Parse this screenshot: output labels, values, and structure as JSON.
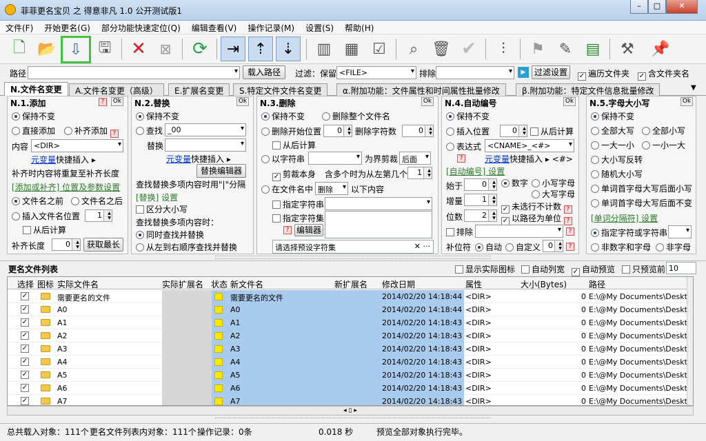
{
  "window": {
    "title": "菲菲更名宝贝 之 得意非凡 1.0 公开测试版1"
  },
  "menu": [
    "文件(F)",
    "开始更名(G)",
    "部分功能快速定位(Q)",
    "编辑查看(V)",
    "操作记录(M)",
    "设置(S)",
    "帮助(H)"
  ],
  "pathbar": {
    "path_label": "路径",
    "load_path": "载入路径",
    "filter_label": "过滤：保留",
    "filter_value": "<FILE>",
    "exclude_label": "排除",
    "filter_button": "过滤设置",
    "traverse_folder": "遍历文件夹",
    "include_folder_name": "含文件夹名"
  },
  "tabs": [
    "N.文件名变更",
    "A.文件名变更（高级）",
    "E.扩展名变更",
    "S.特定文件文件名变更",
    "α.附加功能：文件属性和时间属性批量修改",
    "β.附加功能：特定文件信息批量修改"
  ],
  "p1": {
    "title": "N.1.添加",
    "ok": "Ok",
    "keep": "保持不变",
    "direct_add": "直接添加",
    "pad_add": "补齐添加",
    "content_label": "内容",
    "content_value": "<DIR>",
    "meta_link": "元变量",
    "quick_insert": "快捷插入",
    "note": "补齐时内容将重复至补齐长度",
    "section": "[添加或补齐] 位置及参数设置",
    "before": "文件名之前",
    "after": "文件名之后",
    "insert_pos": "插入文件名位置",
    "insert_val": "1",
    "from_back": "从后计算",
    "pad_len_label": "补齐长度",
    "pad_len_val": "0",
    "get_longest": "获取最长"
  },
  "p2": {
    "title": "N.2.替换",
    "ok": "Ok",
    "keep": "保持不变",
    "find": "查找",
    "find_value": "_00",
    "replace": "替换",
    "meta_link": "元变量",
    "quick_insert": "快捷插入",
    "editor": "替换编辑器",
    "note": "查找替换多项内容时用\"|\"分隔",
    "section": "[替换] 设置",
    "case": "区分大小写",
    "multi_label": "查找替换多项内容时：",
    "simul": "同时查找并替换",
    "seq": "从左到右顺序查找并替换"
  },
  "p3": {
    "title": "N.3.删除",
    "ok": "Ok",
    "keep": "保持不变",
    "delete_all": "删除整个文件名",
    "del_start": "删除开始位置",
    "del_start_val": "0",
    "del_count": "删除字符数",
    "del_count_val": "0",
    "from_back": "从后计算",
    "by_string": "以字符串",
    "boundary": "为界剪裁",
    "side": "后面",
    "cut_self": "剪裁本身",
    "multi": "含多个时为从左第几个",
    "multi_val": "1",
    "in_name": "在文件名中",
    "action": "删除",
    "following": "以下内容",
    "spec_str": "指定字符串",
    "spec_set": "指定字符集",
    "editor": "编辑器",
    "preset": "请选择预设字符集"
  },
  "p4": {
    "title": "N.4.自动编号",
    "ok": "Ok",
    "keep": "保持不变",
    "insert_pos": "插入位置",
    "insert_val": "0",
    "from_back": "从后计算",
    "expr": "表达式",
    "expr_val": "<CNAME>_<#>",
    "meta_link": "元变量",
    "quick_insert": "快捷插入",
    "hash": "<#>",
    "section": "[自动编号] 设置",
    "start": "始于",
    "start_val": "0",
    "step": "增量",
    "step_val": "1",
    "digits": "位数",
    "digits_val": "2",
    "num": "数字",
    "lower": "小写字母",
    "upper": "大写字母",
    "skip_unselected": "未选行不计数",
    "by_path": "以路径为单位",
    "exclude": "排除",
    "pad_char": "补位符",
    "auto": "自动",
    "custom": "自定义",
    "custom_val": "0"
  },
  "p5": {
    "title": "N.5.字母大小写",
    "ok": "Ok",
    "keep": "保持不变",
    "all_upper": "全部大写",
    "all_lower": "全部小写",
    "one_upper": "一大一小",
    "one_lower": "一小一大",
    "invert": "大小写反转",
    "random": "随机大小写",
    "word_upper": "单词首字母大写后面小写",
    "word_keep": "单词首字母大写后面不变",
    "section": "[单词分隔符] 设置",
    "spec": "指定字符或字符串",
    "non_num_letter": "非数字和字母",
    "non_letter": "非字母"
  },
  "list": {
    "title": "更名文件列表",
    "show_icon": "显示实际图标",
    "auto_width": "自动列宽",
    "auto_preview": "自动预览",
    "preview_first": "只预览前",
    "preview_n": "10",
    "columns": [
      "选择",
      "图标",
      "实际文件名",
      "实际扩展名",
      "状态",
      "新文件名",
      "新扩展名",
      "修改日期",
      "属性",
      "大小(Bytes)",
      "路径"
    ],
    "rows": [
      {
        "name": "需要更名的文件",
        "new": "需要更名的文件",
        "date": "2014/02/20 14:18:44",
        "attr": "<DIR>",
        "size": "0",
        "path": "E:\\@My Documents\\Desktop"
      },
      {
        "name": "A0",
        "new": "A0",
        "date": "2014/02/20 14:18:44",
        "attr": "<DIR>",
        "size": "0",
        "path": "E:\\@My Documents\\Desktop"
      },
      {
        "name": "A1",
        "new": "A1",
        "date": "2014/02/20 14:18:43",
        "attr": "<DIR>",
        "size": "0",
        "path": "E:\\@My Documents\\Desktop"
      },
      {
        "name": "A2",
        "new": "A2",
        "date": "2014/02/20 14:18:43",
        "attr": "<DIR>",
        "size": "0",
        "path": "E:\\@My Documents\\Desktop"
      },
      {
        "name": "A3",
        "new": "A3",
        "date": "2014/02/20 14:18:43",
        "attr": "<DIR>",
        "size": "0",
        "path": "E:\\@My Documents\\Desktop"
      },
      {
        "name": "A4",
        "new": "A4",
        "date": "2014/02/20 14:18:43",
        "attr": "<DIR>",
        "size": "0",
        "path": "E:\\@My Documents\\Desktop"
      },
      {
        "name": "A5",
        "new": "A5",
        "date": "2014/02/20 14:18:43",
        "attr": "<DIR>",
        "size": "0",
        "path": "E:\\@My Documents\\Desktop"
      },
      {
        "name": "A6",
        "new": "A6",
        "date": "2014/02/20 14:18:43",
        "attr": "<DIR>",
        "size": "0",
        "path": "E:\\@My Documents\\Desktop"
      },
      {
        "name": "A7",
        "new": "A7",
        "date": "2014/02/20 14:18:43",
        "attr": "<DIR>",
        "size": "0",
        "path": "E:\\@My Documents\\Desktop"
      }
    ]
  },
  "status": {
    "total": "总共载入对象：111个",
    "listed": "更名文件列表内对象：111个",
    "ops": "操作记录：0条",
    "time": "0.018 秒",
    "msg": "预览全部对象执行完毕。"
  }
}
